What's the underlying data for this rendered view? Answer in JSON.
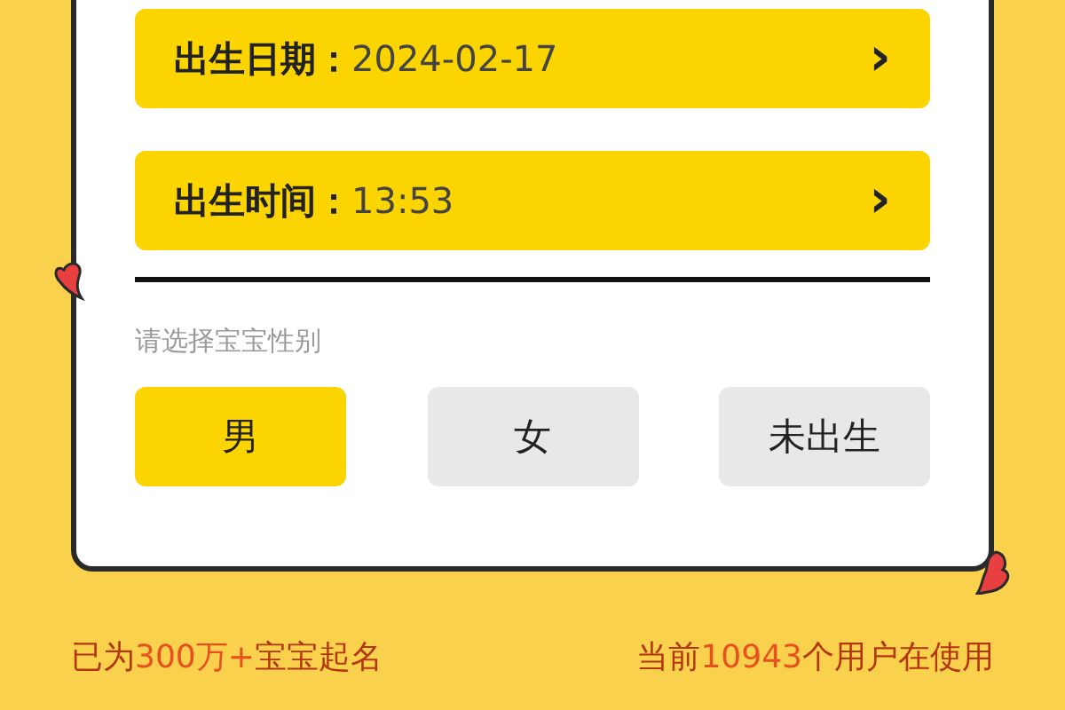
{
  "fields": [
    {
      "label": "出生日期：",
      "value": "2024-02-17",
      "chevron": "›"
    },
    {
      "label": "出生时间：",
      "value": "13:53",
      "chevron": "›"
    }
  ],
  "gender": {
    "prompt": "请选择宝宝性别",
    "options": [
      {
        "label": "男",
        "selected": true
      },
      {
        "label": "女",
        "selected": false
      },
      {
        "label": "未出生",
        "selected": false
      }
    ]
  },
  "stats": [
    {
      "before": "已为",
      "number": "300万+",
      "after": "宝宝起名"
    },
    {
      "before": "当前",
      "number": "10943",
      "after": "个用户在使用"
    }
  ]
}
